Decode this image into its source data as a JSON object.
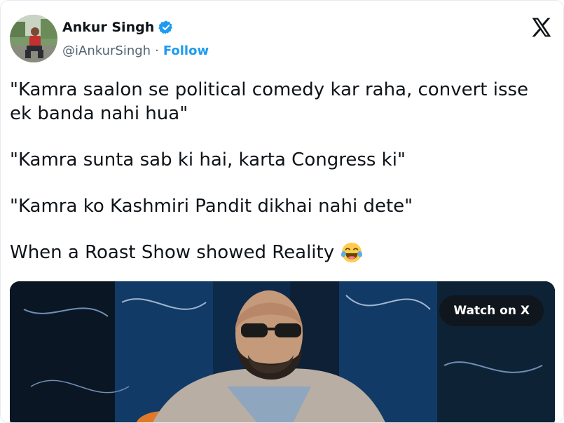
{
  "author": {
    "name": "Ankur Singh",
    "handle": "@iAnkurSingh",
    "separator": "·",
    "follow_label": "Follow",
    "verified": true
  },
  "header": {
    "logo_icon": "x-logo-icon"
  },
  "tweet": {
    "paragraphs": [
      "\"Kamra saalon se political comedy kar raha, convert isse ek banda nahi hua\"",
      "\"Kamra sunta sab ki hai, karta Congress ki\"",
      "\"Kamra ko Kashmiri Pandit dikhai nahi dete\"",
      "When a Roast Show showed Reality"
    ],
    "emoji": "face-with-tears-of-joy"
  },
  "media": {
    "watch_label": "Watch on X"
  },
  "colors": {
    "accent": "#1d9bf0",
    "text": "#0f1419",
    "secondary": "#536471"
  }
}
